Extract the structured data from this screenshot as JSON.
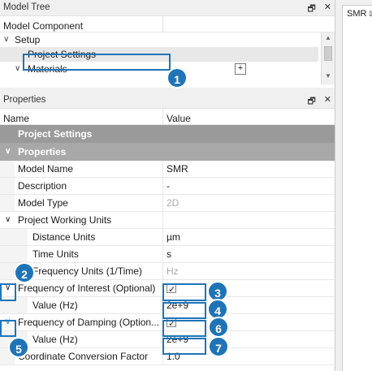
{
  "model_tree": {
    "title": "Model Tree",
    "header_col1": "Model Component",
    "items": [
      {
        "label": "Setup"
      },
      {
        "label": "Project Settings"
      },
      {
        "label": "Materials"
      }
    ],
    "plus_label": "+"
  },
  "properties": {
    "title": "Properties",
    "col_name": "Name",
    "col_value": "Value",
    "section_project_settings": "Project Settings",
    "section_properties": "Properties",
    "rows": {
      "model_name": {
        "name": "Model Name",
        "value": "SMR"
      },
      "description": {
        "name": "Description",
        "value": "-"
      },
      "model_type": {
        "name": "Model Type",
        "value": "2D"
      },
      "project_working_units": {
        "name": "Project Working Units"
      },
      "distance_units": {
        "name": "Distance Units",
        "value": "µm"
      },
      "time_units": {
        "name": "Time Units",
        "value": "s"
      },
      "frequency_units": {
        "name": "Frequency Units (1/Time)",
        "value": "Hz"
      },
      "frequency_of_interest": {
        "name": "Frequency of Interest (Optional)"
      },
      "foi_value": {
        "name": "Value (Hz)",
        "value": "2e+9"
      },
      "frequency_of_damping": {
        "name": "Frequency of Damping (Option..."
      },
      "fod_value": {
        "name": "Value (Hz)",
        "value": "2e+9"
      },
      "coord_conversion": {
        "name": "Coordinate Conversion Factor",
        "value": "1.0"
      }
    }
  },
  "badges": [
    "1",
    "2",
    "3",
    "4",
    "5",
    "6",
    "7"
  ],
  "tab": {
    "label": "SMR",
    "close": "☒"
  },
  "icons": {
    "pin": "pin-icon",
    "close": "close-icon"
  },
  "colors": {
    "accent": "#1f74b8",
    "section": "#9a9a9a"
  }
}
